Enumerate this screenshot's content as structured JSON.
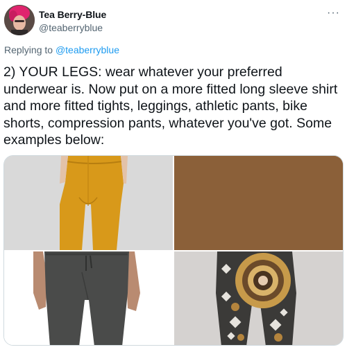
{
  "author": {
    "display_name": "Tea Berry-Blue",
    "handle": "@teaberryblue"
  },
  "replying": {
    "prefix": "Replying to",
    "handle": "@teaberryblue"
  },
  "tweet": {
    "text": "2) YOUR LEGS: wear whatever your preferred underwear is. Now put on a more fitted long sleeve shirt and more fitted tights, leggings, athletic pants, bike shorts, compression pants, whatever you've got. Some examples below:"
  },
  "menu": {
    "more_glyph": "···"
  },
  "media": {
    "colors": {
      "mustard_tights": "#d8991a",
      "brown_swatch": "#8b6039",
      "gray_pants": "#4a4b4a",
      "pattern_gold": "#c79a4a"
    }
  }
}
